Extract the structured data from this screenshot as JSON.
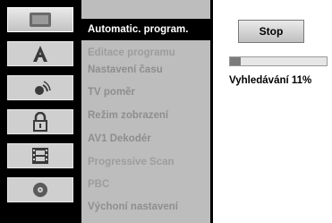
{
  "menu": {
    "items": [
      {
        "label": "Automatic. program.",
        "state": "selected"
      },
      {
        "label": "Editace programu",
        "state": "dim"
      },
      {
        "label": "Nastavení času",
        "state": "normal"
      },
      {
        "label": "TV poměr",
        "state": "normal"
      },
      {
        "label": "Režim zobrazení",
        "state": "normal"
      },
      {
        "label": "AV1 Dekodér",
        "state": "normal"
      },
      {
        "label": "Progressive Scan",
        "state": "dim"
      },
      {
        "label": "PBC",
        "state": "dim"
      },
      {
        "label": "Výchoní nastavení",
        "state": "normal"
      }
    ]
  },
  "sidebar": {
    "icons": [
      {
        "name": "monitor-icon",
        "active": true
      },
      {
        "name": "language-icon",
        "active": false
      },
      {
        "name": "audio-icon",
        "active": false
      },
      {
        "name": "lock-icon",
        "active": false
      },
      {
        "name": "film-icon",
        "active": false
      },
      {
        "name": "disc-icon",
        "active": false
      }
    ]
  },
  "panel": {
    "stop_label": "Stop",
    "progress_percent": 11,
    "search_text": "Vyhledávání  11%"
  },
  "colors": {
    "selected_bg": "#000000",
    "menu_bg": "#bdbdbd",
    "dim_text": "#9d9d9d"
  }
}
